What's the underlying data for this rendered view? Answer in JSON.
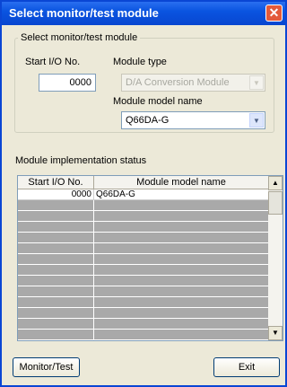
{
  "window": {
    "title": "Select monitor/test module",
    "close_glyph": "✕"
  },
  "select_group": {
    "title": "Select monitor/test module",
    "start_io_label": "Start I/O No.",
    "start_io_value": "0000",
    "module_type_label": "Module type",
    "module_type_value": "D/A Conversion Module",
    "model_name_label": "Module model name",
    "model_name_value": "Q66DA-G"
  },
  "status": {
    "label": "Module implementation status",
    "columns": [
      "Start I/O No.",
      "Module model name"
    ],
    "rows": [
      {
        "start_io": "0000",
        "model": "Q66DA-G"
      }
    ],
    "empty_rows": 13
  },
  "buttons": {
    "monitor_test": "Monitor/Test",
    "exit": "Exit"
  }
}
